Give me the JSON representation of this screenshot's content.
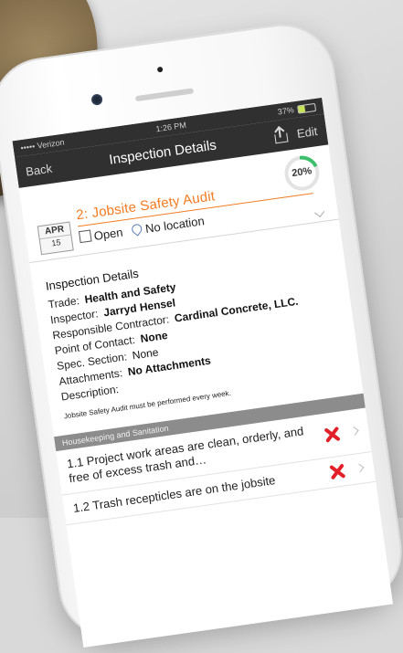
{
  "status_bar": {
    "carrier": "••••• Verizon",
    "time": "1:26 PM",
    "battery": "37%",
    "battery_level": 0.37
  },
  "nav": {
    "back_label": "Back",
    "title": "Inspection Details",
    "edit_label": "Edit"
  },
  "inspection": {
    "title": "2: Jobsite Safety Audit",
    "date_month": "APR",
    "date_day": "15",
    "status": "Open",
    "location": "No location",
    "progress_percent": 20,
    "progress_label": "20%"
  },
  "details": {
    "heading": "Inspection Details",
    "trade_label": "Trade:",
    "trade_value": "Health and Safety",
    "inspector_label": "Inspector:",
    "inspector_value": "Jarryd Hensel",
    "contractor_label": "Responsible Contractor:",
    "contractor_value": "Cardinal Concrete, LLC.",
    "contact_label": "Point of Contact:",
    "contact_value": "None",
    "spec_label": "Spec. Section:",
    "spec_value": "None",
    "attachments_label": "Attachments:",
    "attachments_value": "No Attachments",
    "description_label": "Description:",
    "description_text": "Jobsite Safety Audit must be performed every week."
  },
  "section": {
    "title": "Housekeeping and Sanitation"
  },
  "items": [
    {
      "label": "1.1 Project work areas are clean, orderly, and free of excess trash and…",
      "result_icon": "x-mark-icon"
    },
    {
      "label": "1.2 Trash recepticles are on the jobsite",
      "result_icon": "x-mark-icon"
    }
  ],
  "colors": {
    "accent": "#f47b20",
    "fail": "#e2202a",
    "progress": "#3cbf6b",
    "navbar": "#303030"
  }
}
